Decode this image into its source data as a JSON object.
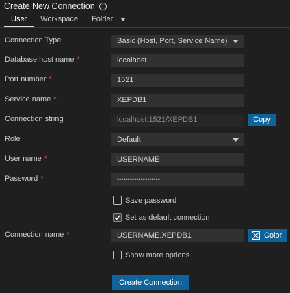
{
  "header": {
    "title": "Create New Connection",
    "info_glyph": "i"
  },
  "tabs": [
    {
      "label": "User",
      "active": true
    },
    {
      "label": "Workspace",
      "active": false
    },
    {
      "label": "Folder",
      "active": false
    }
  ],
  "form": {
    "connection_type": {
      "label": "Connection Type",
      "value": "Basic (Host, Port, Service Name)"
    },
    "host": {
      "label": "Database host name",
      "required_mark": "*",
      "value": "localhost"
    },
    "port": {
      "label": "Port number",
      "required_mark": "*",
      "value": "1521"
    },
    "service": {
      "label": "Service name",
      "required_mark": "*",
      "value": "XEPDB1"
    },
    "connection_string": {
      "label": "Connection string",
      "value": "localhost:1521/XEPDB1",
      "copy_label": "Copy"
    },
    "role": {
      "label": "Role",
      "value": "Default"
    },
    "username": {
      "label": "User name",
      "required_mark": "*",
      "value": "USERNAME"
    },
    "password": {
      "label": "Password",
      "required_mark": "*",
      "value": "••••••••••••••••••••"
    },
    "save_password": {
      "label": "Save password",
      "checked": false
    },
    "default_connection": {
      "label": "Set as default connection",
      "checked": true
    },
    "connection_name": {
      "label": "Connection name",
      "required_mark": "*",
      "value": "USERNAME.XEPDB1",
      "color_label": "Color"
    },
    "show_more": {
      "label": "Show more options",
      "checked": false
    }
  },
  "actions": {
    "create_label": "Create Connection"
  },
  "colors": {
    "accent": "#0e639c",
    "required": "#f14c4c",
    "background": "#1f1f1f",
    "input": "#313131"
  }
}
